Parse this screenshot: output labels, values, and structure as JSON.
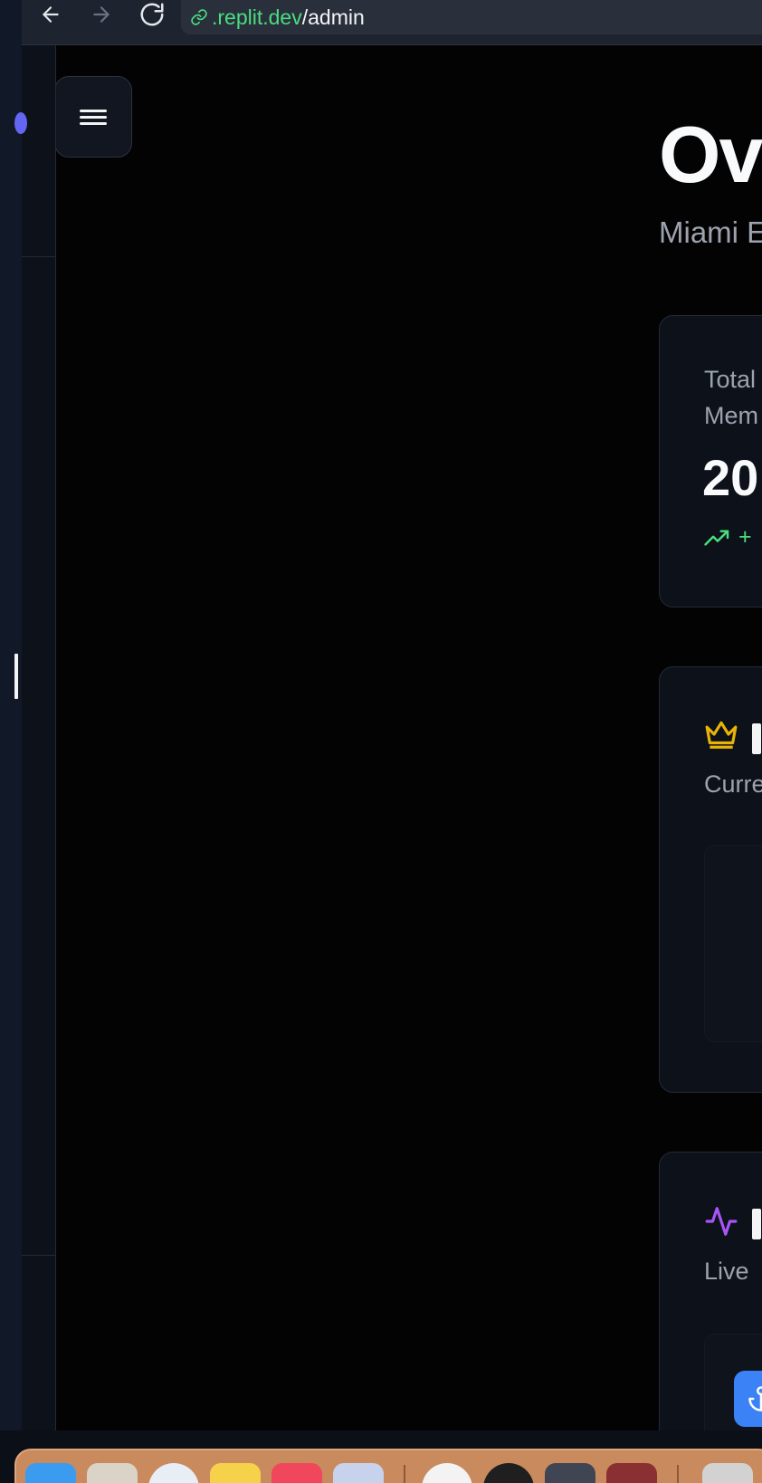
{
  "browser": {
    "url_host": ".replit.dev",
    "url_path": "/admin"
  },
  "page": {
    "title": "Ov",
    "subtitle": "Miami E"
  },
  "stats_card": {
    "label_line1": "Total",
    "label_line2": "Mem",
    "value": "20",
    "trend": "+",
    "trend_color": "#4ade80"
  },
  "card_two": {
    "icon": "crown-icon",
    "icon_color": "#eab308",
    "description": "Curre"
  },
  "card_three": {
    "icon": "activity-icon",
    "icon_color": "#a855f7",
    "description": "Live",
    "button_icon": "anchor-icon",
    "button_color": "#3b82f6"
  },
  "dock": {
    "icons": [
      "finder-icon",
      "launchpad-icon",
      "safari-icon",
      "notes-icon",
      "music-icon",
      "preview-icon",
      "chrome-icon",
      "activity-monitor-icon",
      "proxyman-icon",
      "dictionary-icon",
      "archive-icon"
    ]
  }
}
